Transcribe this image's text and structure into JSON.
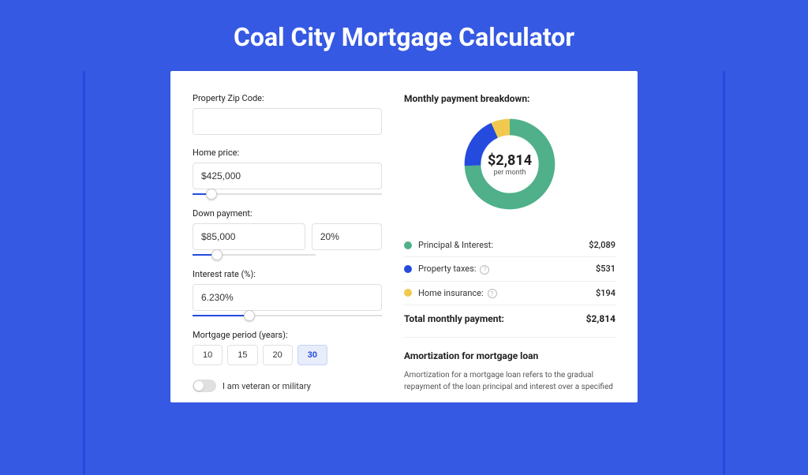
{
  "page_title": "Coal City Mortgage Calculator",
  "form": {
    "zip_label": "Property Zip Code:",
    "zip_value": "",
    "price_label": "Home price:",
    "price_value": "$425,000",
    "price_slider_pct": 10,
    "down_label": "Down payment:",
    "down_value": "$85,000",
    "down_pct_value": "20%",
    "down_slider_pct": 20,
    "rate_label": "Interest rate (%):",
    "rate_value": "6.230%",
    "rate_slider_pct": 30,
    "period_label": "Mortgage period (years):",
    "periods": [
      "10",
      "15",
      "20",
      "30"
    ],
    "period_active_index": 3,
    "veteran_label": "I am veteran or military",
    "veteran_on": false
  },
  "results": {
    "title": "Monthly payment breakdown:",
    "center_amount": "$2,814",
    "center_sub": "per month",
    "items": [
      {
        "label": "Principal & Interest:",
        "value": "$2,089",
        "color": "#4fb08a",
        "has_info": false,
        "numeric": 2089
      },
      {
        "label": "Property taxes:",
        "value": "$531",
        "color": "#244bdd",
        "has_info": true,
        "numeric": 531
      },
      {
        "label": "Home insurance:",
        "value": "$194",
        "color": "#f0c94e",
        "has_info": true,
        "numeric": 194
      }
    ],
    "total_label": "Total monthly payment:",
    "total_value": "$2,814",
    "total_numeric": 2814
  },
  "amortization": {
    "title": "Amortization for mortgage loan",
    "text": "Amortization for a mortgage loan refers to the gradual repayment of the loan principal and interest over a specified"
  },
  "chart_data": {
    "type": "pie",
    "title": "Monthly payment breakdown",
    "categories": [
      "Principal & Interest",
      "Property taxes",
      "Home insurance"
    ],
    "values": [
      2089,
      531,
      194
    ],
    "colors": [
      "#4fb08a",
      "#244bdd",
      "#f0c94e"
    ],
    "center_label": "$2,814 per month"
  }
}
